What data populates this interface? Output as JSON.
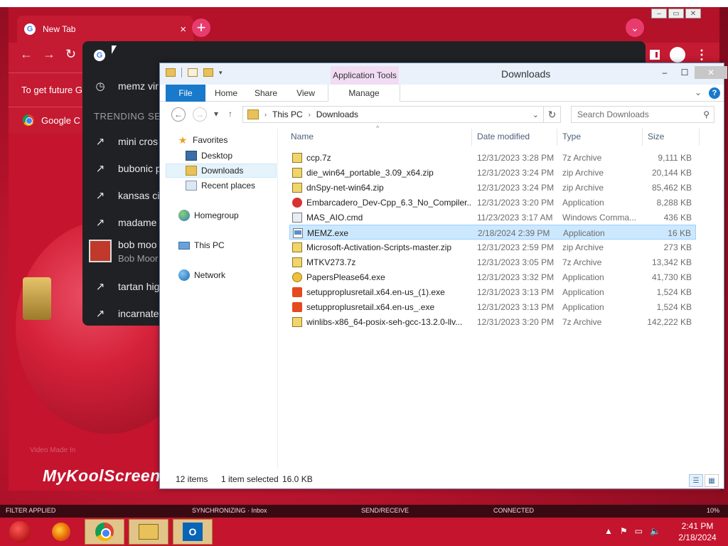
{
  "chrome": {
    "tab_title": "New Tab",
    "infobar_text": "To get future G",
    "bookmark_label": "Google C",
    "omnibox_dropdown": {
      "first_item": "memz vir",
      "heading": "TRENDING SEA",
      "items": [
        "mini cros",
        "bubonic p",
        "kansas cit",
        "madame"
      ],
      "rich_item_title": "bob moo",
      "rich_item_sub": "Bob Moor",
      "items2": [
        "tartan hig",
        "incarnate"
      ]
    }
  },
  "wallpaper": {
    "small_text": "Video Made In",
    "watermark": "MyKoolScreen"
  },
  "explorer": {
    "title": "Downloads",
    "context_tab": "Application Tools",
    "ribbon_tabs": [
      "File",
      "Home",
      "Share",
      "View",
      "Manage"
    ],
    "breadcrumb": [
      "This PC",
      "Downloads"
    ],
    "search_placeholder": "Search Downloads",
    "nav": {
      "favorites": "Favorites",
      "desktop": "Desktop",
      "downloads": "Downloads",
      "recent": "Recent places",
      "homegroup": "Homegroup",
      "thispc": "This PC",
      "network": "Network"
    },
    "columns": [
      "Name",
      "Date modified",
      "Type",
      "Size"
    ],
    "files": [
      {
        "name": "ccp.7z",
        "date": "12/31/2023 3:28 PM",
        "type": "7z Archive",
        "size": "9,111 KB",
        "icon": "zip"
      },
      {
        "name": "die_win64_portable_3.09_x64.zip",
        "date": "12/31/2023 3:24 PM",
        "type": "zip Archive",
        "size": "20,144 KB",
        "icon": "zip"
      },
      {
        "name": "dnSpy-net-win64.zip",
        "date": "12/31/2023 3:24 PM",
        "type": "zip Archive",
        "size": "85,462 KB",
        "icon": "zip"
      },
      {
        "name": "Embarcadero_Dev-Cpp_6.3_No_Compiler...",
        "date": "12/31/2023 3:20 PM",
        "type": "Application",
        "size": "8,288 KB",
        "icon": "emb"
      },
      {
        "name": "MAS_AIO.cmd",
        "date": "11/23/2023 3:17 AM",
        "type": "Windows Comma...",
        "size": "436 KB",
        "icon": "cmd"
      },
      {
        "name": "MEMZ.exe",
        "date": "2/18/2024 2:39 PM",
        "type": "Application",
        "size": "16 KB",
        "icon": "app"
      },
      {
        "name": "Microsoft-Activation-Scripts-master.zip",
        "date": "12/31/2023 2:59 PM",
        "type": "zip Archive",
        "size": "273 KB",
        "icon": "zip"
      },
      {
        "name": "MTKV273.7z",
        "date": "12/31/2023 3:05 PM",
        "type": "7z Archive",
        "size": "13,342 KB",
        "icon": "zip"
      },
      {
        "name": "PapersPlease64.exe",
        "date": "12/31/2023 3:32 PM",
        "type": "Application",
        "size": "41,730 KB",
        "icon": "pp"
      },
      {
        "name": "setupproplusretail.x64.en-us_(1).exe",
        "date": "12/31/2023 3:13 PM",
        "type": "Application",
        "size": "1,524 KB",
        "icon": "off"
      },
      {
        "name": "setupproplusretail.x64.en-us_.exe",
        "date": "12/31/2023 3:13 PM",
        "type": "Application",
        "size": "1,524 KB",
        "icon": "off"
      },
      {
        "name": "winlibs-x86_64-posix-seh-gcc-13.2.0-llv...",
        "date": "12/31/2023 3:20 PM",
        "type": "7z Archive",
        "size": "142,222 KB",
        "icon": "zip"
      }
    ],
    "selected_index": 5,
    "status": {
      "item_count": "12 items",
      "selection": "1 item selected",
      "selection_size": "16.0 KB"
    }
  },
  "outlook_status": {
    "filter": "FILTER APPLIED",
    "sync": "SYNCHRONIZING · Inbox",
    "send_receive": "SEND/RECEIVE",
    "connected": "CONNECTED",
    "zoom": "10%"
  },
  "taskbar": {
    "time": "2:41 PM",
    "date": "2/18/2024"
  }
}
